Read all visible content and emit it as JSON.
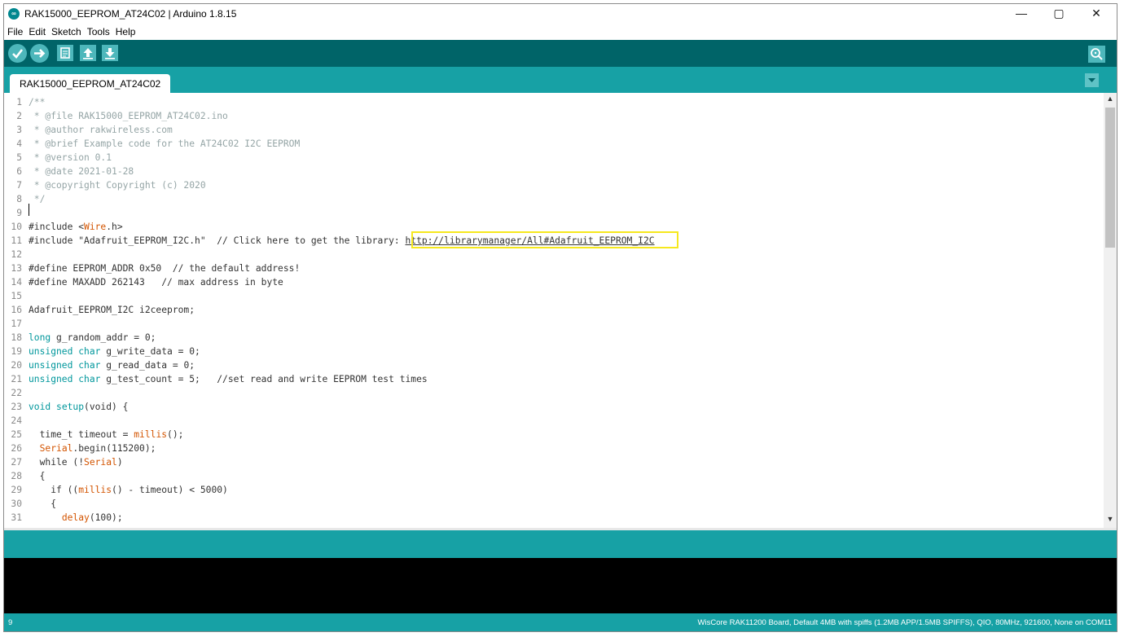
{
  "window": {
    "title": "RAK15000_EEPROM_AT24C02 | Arduino 1.8.15",
    "app_icon_label": "∞",
    "controls": {
      "minimize": "—",
      "maximize": "▢",
      "close": "✕"
    }
  },
  "menu": [
    "File",
    "Edit",
    "Sketch",
    "Tools",
    "Help"
  ],
  "tab": {
    "label": "RAK15000_EEPROM_AT24C02"
  },
  "toolbar": {
    "verify": "✓",
    "upload": "➜",
    "new": "▤",
    "open": "⬆",
    "save": "⬇",
    "serial_monitor": "⚲"
  },
  "tab_menu_glyph": "▾",
  "scroll": {
    "up": "▲",
    "down": "▼"
  },
  "code": [
    {
      "n": "1",
      "t": "/**"
    },
    {
      "n": "2",
      "t": " * @file RAK15000_EEPROM_AT24C02.ino"
    },
    {
      "n": "3",
      "t": " * @author rakwireless.com"
    },
    {
      "n": "4",
      "t": " * @brief Example code for the AT24C02 I2C EEPROM"
    },
    {
      "n": "5",
      "t": " * @version 0.1"
    },
    {
      "n": "6",
      "t": " * @date 2021-01-28"
    },
    {
      "n": "7",
      "t": " * @copyright Copyright (c) 2020"
    },
    {
      "n": "8",
      "t": " */"
    },
    {
      "n": "9",
      "t": ""
    },
    {
      "n": "10",
      "a": "#include <",
      "b": "Wire",
      "c": ".h>"
    },
    {
      "n": "11",
      "a": "#include \"Adafruit_EEPROM_I2C.h\"  // Click here to get the library: ",
      "link": "http://librarymanager/All#Adafruit_EEPROM_I2C"
    },
    {
      "n": "12",
      "t": ""
    },
    {
      "n": "13",
      "t": "#define EEPROM_ADDR 0x50  // the default address!"
    },
    {
      "n": "14",
      "t": "#define MAXADD 262143   // max address in byte"
    },
    {
      "n": "15",
      "t": ""
    },
    {
      "n": "16",
      "t": "Adafruit_EEPROM_I2C i2ceeprom;"
    },
    {
      "n": "17",
      "t": ""
    },
    {
      "n": "18",
      "k": "long",
      "r": " g_random_addr = 0;"
    },
    {
      "n": "19",
      "k": "unsigned char",
      "r": " g_write_data = 0;"
    },
    {
      "n": "20",
      "k": "unsigned char",
      "r": " g_read_data = 0;"
    },
    {
      "n": "21",
      "k": "unsigned char",
      "r": " g_test_count = 5;   //set read and write EEPROM test times"
    },
    {
      "n": "22",
      "t": ""
    },
    {
      "n": "23",
      "a": "void ",
      "fname": "setup",
      "c": "(void) {"
    },
    {
      "n": "24",
      "t": ""
    },
    {
      "n": "25",
      "a": "  time_t timeout = ",
      "fname": "millis",
      "c": "();"
    },
    {
      "n": "26",
      "a": "  ",
      "fname": "Serial",
      "c": ".begin(115200);"
    },
    {
      "n": "27",
      "a": "  while (!",
      "fname": "Serial",
      "c": ")"
    },
    {
      "n": "28",
      "t": "  {"
    },
    {
      "n": "29",
      "a": "    if ((",
      "fname": "millis",
      "c": "() - timeout) < 5000)"
    },
    {
      "n": "30",
      "t": "    {"
    },
    {
      "n": "31",
      "a": "      ",
      "fname": "delay",
      "c": "(100);"
    }
  ],
  "status": {
    "line": "9",
    "board": "WisCore RAK11200 Board, Default 4MB with spiffs (1.2MB APP/1.5MB SPIFFS), QIO, 80MHz, 921600, None on COM11"
  }
}
